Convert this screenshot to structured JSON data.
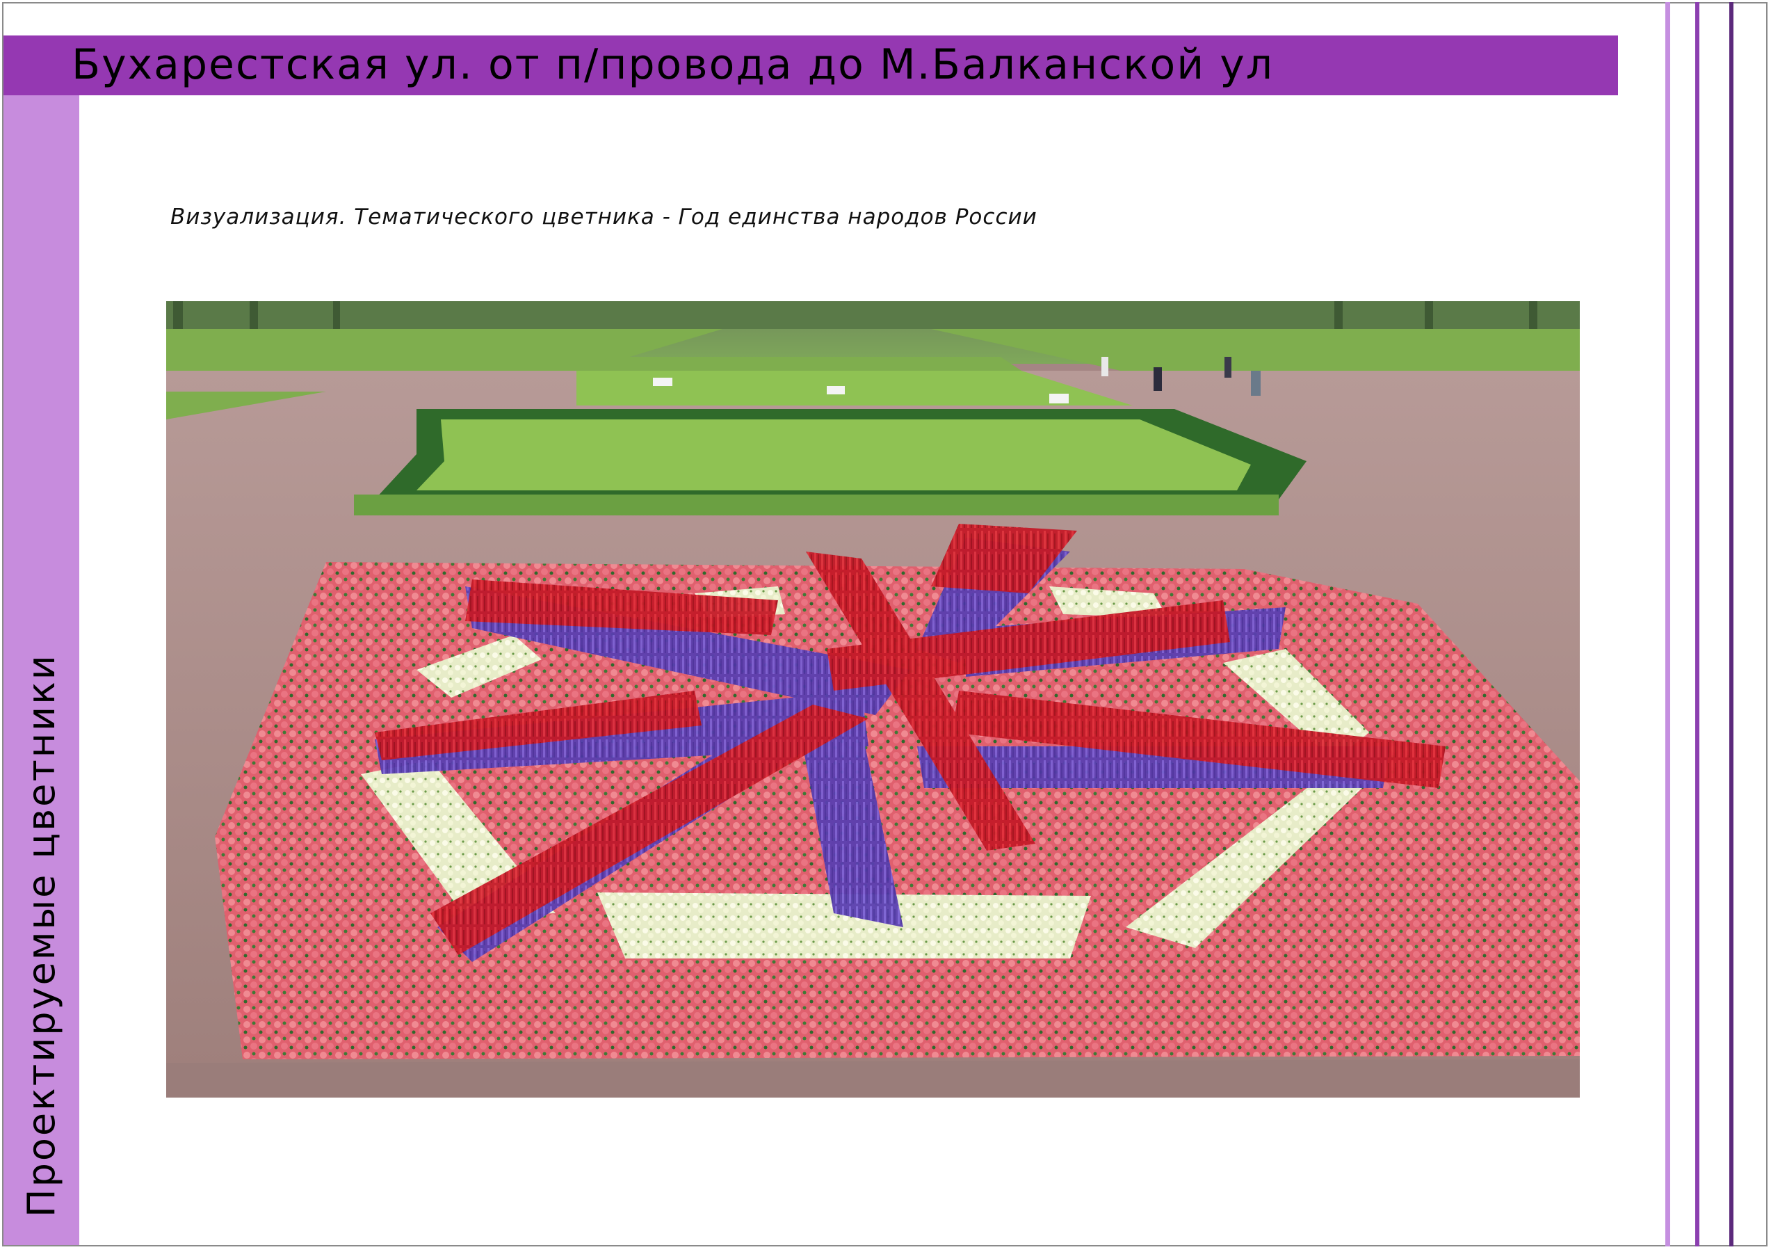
{
  "header": {
    "title": "Бухарестская ул. от п/провода до М.Балканской ул"
  },
  "sidebar": {
    "vertical_label": "Проектируемые цветники"
  },
  "content": {
    "caption": "Визуализация. Тематического цветника - Год единства народов России"
  },
  "colors": {
    "title_bar": "#9538b2",
    "side_bar": "#c78cdd",
    "accent_line_light": "#c58fe0",
    "accent_line_mid": "#8c3fb0",
    "accent_line_dark": "#5c2a7c"
  }
}
